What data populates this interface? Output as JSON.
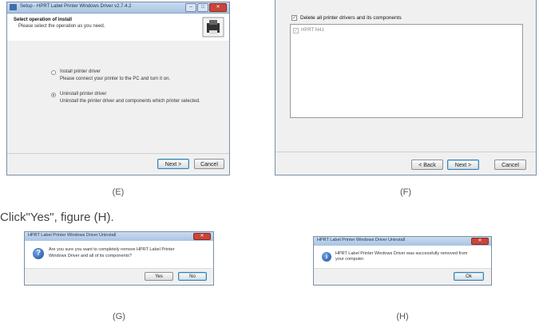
{
  "figE": {
    "caption": "(E)",
    "title": "Setup - HPRT Label Printer Windows Driver v2.7.4.2",
    "header_title": "Select operation of install",
    "header_sub": "Please select the operation as you need.",
    "option1_label": "Install printer driver",
    "option1_desc": "Please connect your printer to the PC and turn it on.",
    "option2_label": "Uninstall printer driver",
    "option2_desc": "Uninstall the printer driver and components which printer selected.",
    "next": "Next >",
    "cancel": "Cancel"
  },
  "figF": {
    "caption": "(F)",
    "delete_label": "Delete all printer drivers and its components",
    "printer_item": "HPRT N41",
    "back": "< Back",
    "next": "Next >",
    "cancel": "Cancel"
  },
  "instruction": "Click\"Yes\", figure (H).",
  "figG": {
    "caption": "(G)",
    "title": "HPRT Label Printer Windows Driver Uninstall",
    "message_line1": "Are you sure you want to completely remove HPRT Label Printer",
    "message_line2": "Windows Driver and all of its components?",
    "yes": "Yes",
    "no": "No"
  },
  "figH": {
    "caption": "(H)",
    "title": "HPRT Label Printer Windows Driver Uninstall",
    "message_line1": "HPRT Label Printer Windows Driver was successfully removed from",
    "message_line2": "your computer.",
    "ok": "Ok"
  }
}
